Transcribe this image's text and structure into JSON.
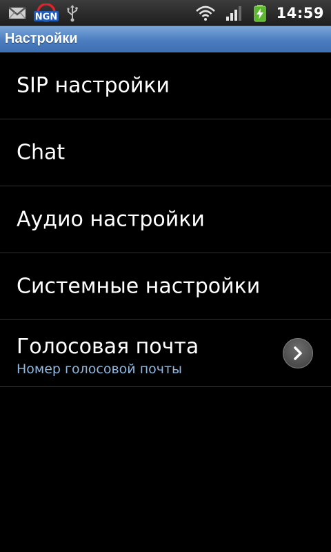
{
  "status_bar": {
    "left_icons": [
      "gmail-icon",
      "ngn-app-icon",
      "usb-icon"
    ],
    "right_icons": [
      "wifi-icon",
      "signal-icon",
      "battery-charging-icon"
    ],
    "time": "14:59"
  },
  "title_bar": {
    "title": "Настройки"
  },
  "settings_list": {
    "items": [
      {
        "label": "SIP настройки"
      },
      {
        "label": "Chat"
      },
      {
        "label": "Аудио настройки"
      },
      {
        "label": "Системные настройки"
      },
      {
        "label": "Голосовая почта",
        "subtitle": "Номер голосовой почты",
        "icon": "chevron-right-icon"
      }
    ]
  },
  "colors": {
    "background": "#000000",
    "title_bar": "#4a7cbf",
    "subtitle_text": "#8fb8e0",
    "divider": "#333333"
  }
}
